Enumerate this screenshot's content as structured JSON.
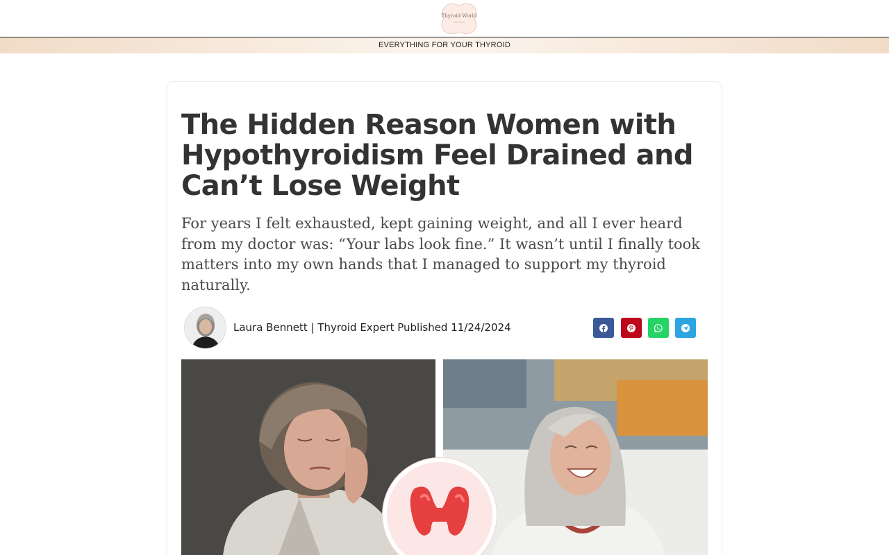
{
  "header": {
    "logo_alt": "Thyroid World",
    "logo_text": "Thyroid World",
    "tagline": "EVERYTHING FOR YOUR THYROID"
  },
  "article": {
    "title": "The Hidden Reason Women with Hypothyroidism Feel Drained and Can’t Lose Weight",
    "subtitle": "For years I felt exhausted, kept gaining weight, and all I ever heard from my doctor was: “Your labs look fine.” It wasn’t until I finally took matters into my own hands that I managed to support my thyroid naturally.",
    "byline": "Laura Bennett | Thyroid Expert Published 11/24/2024"
  },
  "share": {
    "buttons": [
      {
        "icon": "facebook-icon",
        "color": "#3b5998"
      },
      {
        "icon": "pinterest-icon",
        "color": "#bd081c"
      },
      {
        "icon": "whatsapp-icon",
        "color": "#25d366"
      },
      {
        "icon": "telegram-icon",
        "color": "#2ca5e0"
      }
    ]
  },
  "hero": {
    "left_image": "tired-woman-photo",
    "right_image": "smiling-woman-photo",
    "badge_icon": "thyroid-gland-icon"
  },
  "colors": {
    "tagbar_accent": "#f1dcc7",
    "heading": "#333333",
    "thyroid": "#e53f3f"
  }
}
